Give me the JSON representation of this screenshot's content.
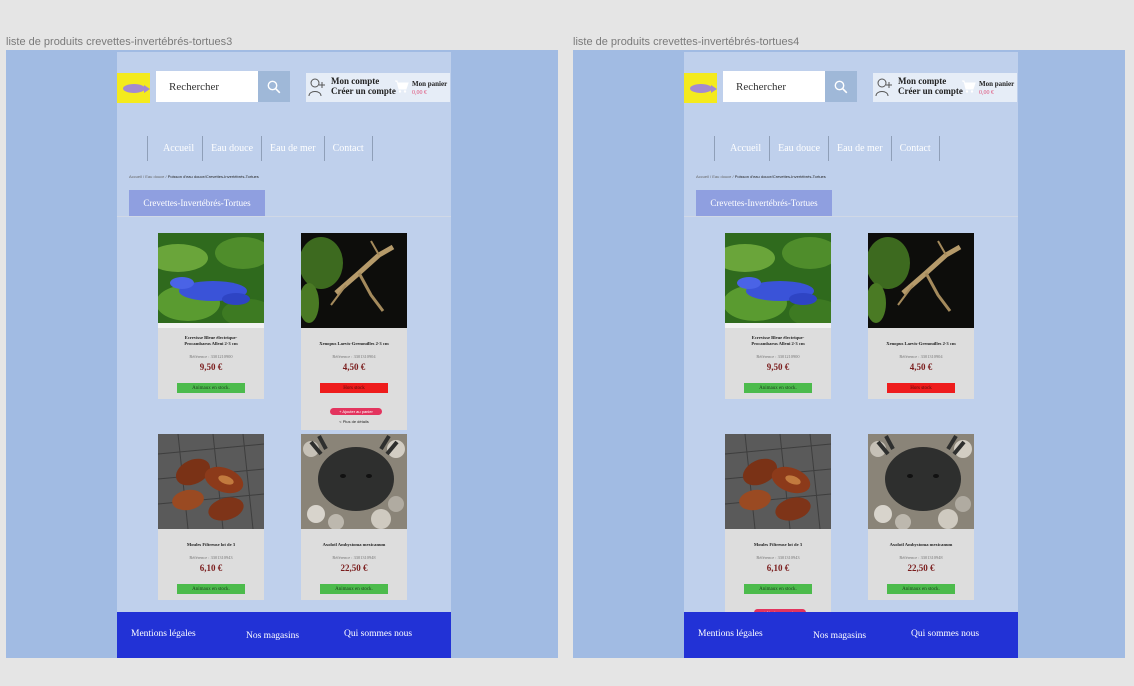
{
  "frames": [
    {
      "label": "liste de produits crevettes-invertébrés-tortues3",
      "hover_card": 1
    },
    {
      "label": "liste de produits crevettes-invertébrés-tortues4",
      "hover_card": 2
    }
  ],
  "header": {
    "search_placeholder": "Rechercher",
    "account_line1": "Mon compte",
    "account_line2": "Créer un compte",
    "cart_label": "Mon panier",
    "cart_total": "0,00 €"
  },
  "nav": [
    "Accueil",
    "Eau douce",
    "Eau de mer",
    "Contact"
  ],
  "breadcrumb": {
    "part1": "Accueil",
    "sep": " / ",
    "part2": "Eau douce",
    "current": "Poisson d'eau douce/Crevettes-Invertébrés-Tortues"
  },
  "category_title": "Crevettes-Invertébrés-Tortues",
  "products": [
    {
      "name_line1": "Ecrevisse Bleue électrique-",
      "name_line2": "Procambarus Alleni 2-3 cm",
      "ref": "Référence : 3301210900",
      "price": "9,50 €",
      "stock": "Animaux en stock.",
      "in_stock": true,
      "image": "blue-crayfish"
    },
    {
      "name_line1": "Xenopus Laevis-Grenouilles 2-3 cm",
      "name_line2": "",
      "ref": "Référence : 3301310904",
      "price": "4,50 €",
      "stock": "Hors stock",
      "in_stock": false,
      "image": "frog"
    },
    {
      "name_line1": "Moules Filtreuse lot de 3",
      "name_line2": "",
      "ref": "Référence : 3301310943",
      "price": "6,10 €",
      "stock": "Animaux en stock.",
      "in_stock": true,
      "image": "mussels"
    },
    {
      "name_line1": "Axolotl Ambystoma mexicanum",
      "name_line2": "",
      "ref": "Référence : 3301310948",
      "price": "22,50 €",
      "stock": "Animaux en stock.",
      "in_stock": true,
      "image": "axolotl"
    }
  ],
  "add_to_cart": "+ Ajouter au panier",
  "details": "< Plus de détails",
  "footer": {
    "legal": "Mentions légales",
    "stores": "Nos magasins",
    "about": "Qui sommes nous"
  },
  "colors": {
    "frame_bg": "#a1bbe3",
    "page_bg": "#bfd0ec",
    "category_tab": "#8f9fe0",
    "footer": "#2232d6",
    "in_stock": "#4cbb4c",
    "out_stock": "#ee1c1c",
    "add_button": "#e3345e",
    "price": "#7a1c1c"
  }
}
